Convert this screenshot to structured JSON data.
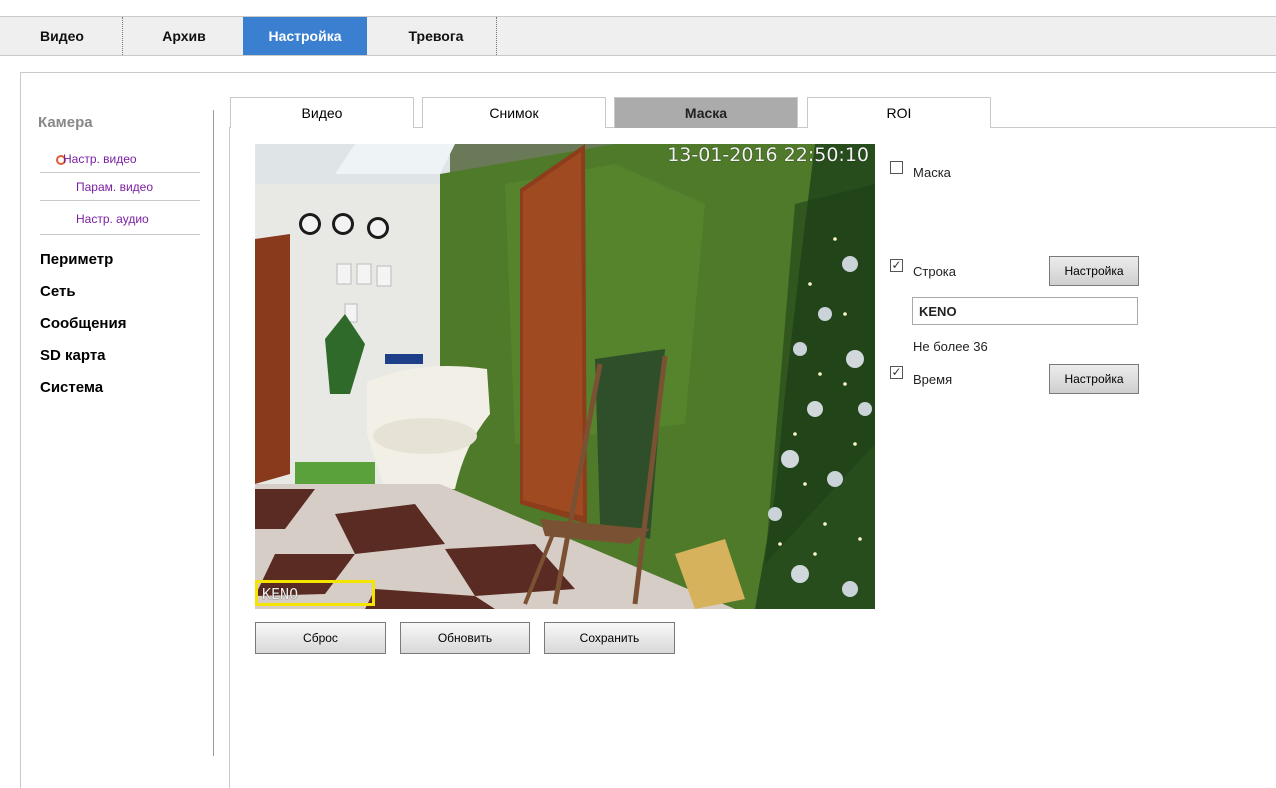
{
  "top_nav": {
    "tabs": [
      {
        "label": "Видео"
      },
      {
        "label": "Архив"
      },
      {
        "label": "Настройка",
        "active": true
      },
      {
        "label": "Тревога"
      }
    ]
  },
  "sidebar": {
    "camera_label": "Камера",
    "camera_items": [
      {
        "label": "Настр. видео",
        "active": true
      },
      {
        "label": "Парам. видео"
      },
      {
        "label": "Настр. аудио"
      }
    ],
    "sections": [
      "Периметр",
      "Сеть",
      "Сообщения",
      "SD карта",
      "Система"
    ]
  },
  "sub_tabs": [
    {
      "label": "Видео"
    },
    {
      "label": "Снимок"
    },
    {
      "label": "Маска",
      "active": true
    },
    {
      "label": "ROI"
    }
  ],
  "preview": {
    "timestamp": "13-01-2016 22:50:10",
    "osd_text": "KENO"
  },
  "options": {
    "mask": {
      "label": "Маска",
      "checked": false
    },
    "string": {
      "label": "Строка",
      "checked": true,
      "button": "Настройка",
      "value": "KENO",
      "hint": "Не более 36"
    },
    "time": {
      "label": "Время",
      "checked": true,
      "button": "Настройка"
    }
  },
  "actions": {
    "reset": "Сброс",
    "refresh": "Обновить",
    "save": "Сохранить"
  },
  "colors": {
    "accent": "#3a7fd0",
    "active_subtab": "#ababab",
    "osd_highlight": "#f5e400",
    "sidebar_link": "#7b1fa2",
    "active_dot": "#e05c3a"
  },
  "icons": [
    "checkbox-unchecked-icon",
    "checkbox-checked-icon",
    "radio-dot-icon"
  ]
}
